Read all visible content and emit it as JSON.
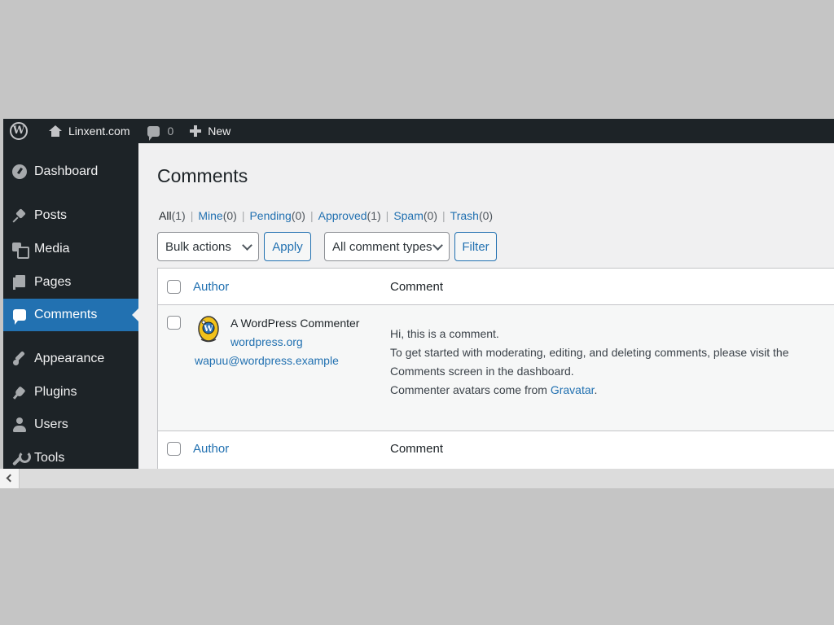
{
  "adminbar": {
    "site_name": "Linxent.com",
    "comment_count": "0",
    "new_label": "New"
  },
  "sidebar": {
    "items": [
      {
        "label": "Dashboard",
        "icon": "dashboard-icon"
      },
      {
        "label": "Posts",
        "icon": "pin-icon"
      },
      {
        "label": "Media",
        "icon": "media-icon"
      },
      {
        "label": "Pages",
        "icon": "pages-icon"
      },
      {
        "label": "Comments",
        "icon": "comments-icon",
        "current": true
      },
      {
        "label": "Appearance",
        "icon": "brush-icon"
      },
      {
        "label": "Plugins",
        "icon": "plug-icon"
      },
      {
        "label": "Users",
        "icon": "user-icon"
      },
      {
        "label": "Tools",
        "icon": "wrench-icon"
      }
    ]
  },
  "main": {
    "title": "Comments",
    "filters": [
      {
        "label": "All",
        "count": "(1)"
      },
      {
        "label": "Mine",
        "count": "(0)"
      },
      {
        "label": "Pending",
        "count": "(0)"
      },
      {
        "label": "Approved",
        "count": "(1)"
      },
      {
        "label": "Spam",
        "count": "(0)"
      },
      {
        "label": "Trash",
        "count": "(0)"
      }
    ],
    "separator": "|",
    "bulk_actions": "Bulk actions",
    "apply_label": "Apply",
    "comment_types": "All comment types",
    "filter_label": "Filter",
    "table": {
      "col_author": "Author",
      "col_comment": "Comment",
      "row": {
        "author_name": "A WordPress Commenter",
        "author_url": "wordpress.org",
        "author_email": "wapuu@wordpress.example",
        "line1": "Hi, this is a comment.",
        "line2": "To get started with moderating, editing, and deleting comments, please visit the Comments screen in the dashboard.",
        "line3_prefix": "Commenter avatars come from ",
        "line3_link": "Gravatar",
        "line3_suffix": "."
      }
    }
  },
  "colors": {
    "sidebar_bg": "#1d2327",
    "accent": "#2271b1",
    "page_bg": "#f0f0f1"
  }
}
